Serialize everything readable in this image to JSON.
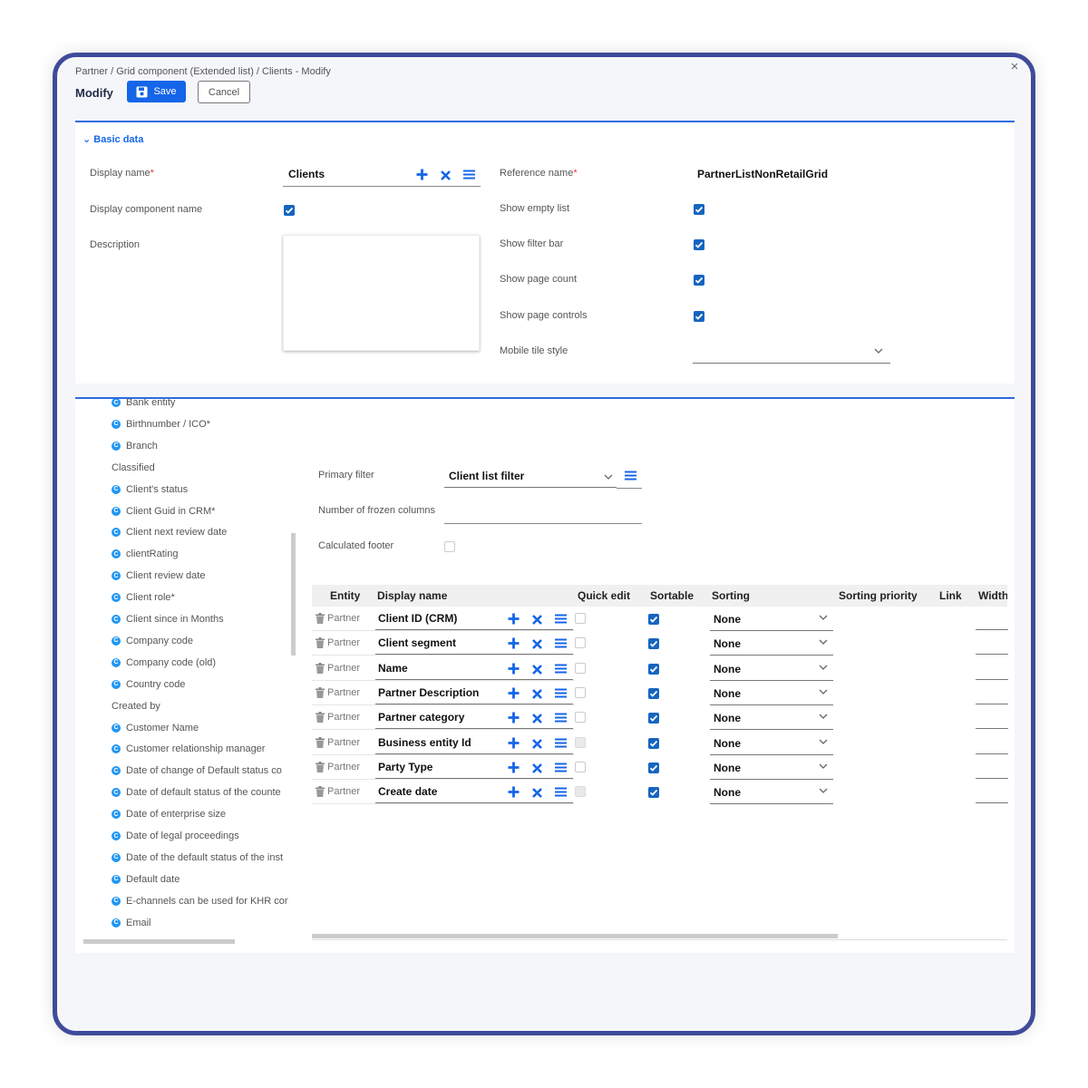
{
  "breadcrumb": "Partner / Grid component (Extended list) / Clients - Modify",
  "title": "Modify",
  "buttons": {
    "save": "Save",
    "cancel": "Cancel"
  },
  "close_icon": "×",
  "basic": {
    "section_title": "Basic data",
    "display_name_label": "Display name",
    "display_name_value": "Clients",
    "display_component_name_label": "Display component name",
    "display_component_name_checked": true,
    "description_label": "Description",
    "reference_name_label": "Reference name",
    "reference_name_value": "PartnerListNonRetailGrid",
    "show_empty_list_label": "Show empty list",
    "show_filter_bar_label": "Show filter bar",
    "show_page_count_label": "Show page count",
    "show_page_controls_label": "Show page controls",
    "mobile_tile_style_label": "Mobile tile style",
    "required_mark": "*"
  },
  "grid": {
    "primary_filter_label": "Primary filter",
    "primary_filter_value": "Client list filter",
    "frozen_columns_label": "Number of frozen columns",
    "calculated_footer_label": "Calculated footer",
    "columns": [
      "Entity",
      "Display name",
      "Quick edit",
      "Sortable",
      "Sorting",
      "Sorting priority",
      "Link",
      "Width"
    ],
    "rows": [
      {
        "entity": "Partner",
        "name": "Client ID (CRM)",
        "quick_edit": "off",
        "sortable": true,
        "sorting": "None"
      },
      {
        "entity": "Partner",
        "name": "Client segment",
        "quick_edit": "off",
        "sortable": true,
        "sorting": "None"
      },
      {
        "entity": "Partner",
        "name": "Name",
        "quick_edit": "off",
        "sortable": true,
        "sorting": "None"
      },
      {
        "entity": "Partner",
        "name": "Partner Description",
        "quick_edit": "off",
        "sortable": true,
        "sorting": "None"
      },
      {
        "entity": "Partner",
        "name": "Partner category",
        "quick_edit": "off",
        "sortable": true,
        "sorting": "None"
      },
      {
        "entity": "Partner",
        "name": "Business entity Id",
        "quick_edit": "disabled",
        "sortable": true,
        "sorting": "None"
      },
      {
        "entity": "Partner",
        "name": "Party Type",
        "quick_edit": "off",
        "sortable": true,
        "sorting": "None"
      },
      {
        "entity": "Partner",
        "name": "Create date",
        "quick_edit": "disabled",
        "sortable": true,
        "sorting": "None"
      }
    ]
  },
  "tree": [
    {
      "type": "item",
      "label": "Bank entity"
    },
    {
      "type": "item",
      "label": "Birthnumber / ICO*"
    },
    {
      "type": "item",
      "label": "Branch"
    },
    {
      "type": "group",
      "label": "Classified"
    },
    {
      "type": "item",
      "label": "Client's status"
    },
    {
      "type": "item",
      "label": "Client Guid in CRM*"
    },
    {
      "type": "item",
      "label": "Client next review date"
    },
    {
      "type": "item",
      "label": "clientRating"
    },
    {
      "type": "item",
      "label": "Client review date"
    },
    {
      "type": "item",
      "label": "Client role*"
    },
    {
      "type": "item",
      "label": "Client since in Months"
    },
    {
      "type": "item",
      "label": "Company code"
    },
    {
      "type": "item",
      "label": "Company code (old)"
    },
    {
      "type": "item",
      "label": "Country code"
    },
    {
      "type": "group",
      "label": "Created by"
    },
    {
      "type": "item",
      "label": "Customer Name"
    },
    {
      "type": "item",
      "label": "Customer relationship manager"
    },
    {
      "type": "item",
      "label": "Date of change of Default status co"
    },
    {
      "type": "item",
      "label": "Date of default status of the counte"
    },
    {
      "type": "item",
      "label": "Date of enterprise size"
    },
    {
      "type": "item",
      "label": "Date of legal proceedings"
    },
    {
      "type": "item",
      "label": "Date of the default status of the inst"
    },
    {
      "type": "item",
      "label": "Default date"
    },
    {
      "type": "item",
      "label": "E-channels can be used for KHR cor"
    },
    {
      "type": "item",
      "label": "Email"
    }
  ],
  "tree_bullet": "C",
  "colors": {
    "accent": "#1565e8",
    "checkbox": "#1565c0",
    "frame": "#3f4b9a",
    "tree_bullet": "#2196f3"
  },
  "icons": [
    "save-icon",
    "close-icon",
    "chevron-down-icon",
    "add-icon",
    "remove-icon",
    "menu-icon",
    "trash-icon",
    "checkmark-icon"
  ]
}
